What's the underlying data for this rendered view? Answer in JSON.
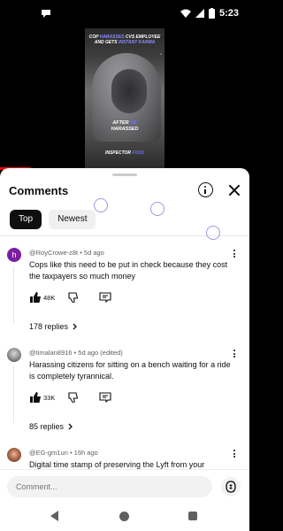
{
  "status_bar": {
    "time": "5:23",
    "icons": [
      "chat-bubble-icon",
      "wifi-icon",
      "signal-icon",
      "battery-charging-icon"
    ]
  },
  "video": {
    "title_pre": "COP ",
    "title_hl": "HARASSES",
    "title_mid": " CVS EMPLOYEE AND GETS ",
    "title_hl2": "INSTANT KARMA",
    "caption_line1_pre": "AFTER ",
    "caption_line1_hl": "HE",
    "caption_line2": "HARASSED",
    "brand_pre": "INSPECTOR ",
    "brand_hl": "FOXX",
    "progress_fraction": 0.12,
    "colors": {
      "progress": "#ff0000",
      "highlight": "#6b73ff"
    }
  },
  "comments_panel": {
    "title": "Comments",
    "info_icon": "info-icon",
    "close_icon": "close-icon",
    "filters": {
      "top": "Top",
      "newest": "Newest"
    },
    "comments": [
      {
        "author_meta": "@RoyCrowe-z8t • 5d ago",
        "text": "Cops like this need to be put in check because they cost the taxpayers so much money",
        "likes": "48K",
        "replies": "178 replies",
        "avatar_letter": "h",
        "avatar_color": "#7b1fa2"
      },
      {
        "author_meta": "@timalan8916 • 5d ago (edited)",
        "text": "Harassing citizens for sitting on a bench waiting for a ride is completely tyrannical.",
        "likes": "33K",
        "replies": "85 replies"
      },
      {
        "author_meta": "@EG-gm1un • 16h ago",
        "text": "Digital time stamp of preserving the Lyft from your"
      }
    ],
    "input_placeholder": "Comment..."
  },
  "nav_bar": {
    "icons": [
      "back-icon",
      "home-icon",
      "recents-icon"
    ]
  }
}
